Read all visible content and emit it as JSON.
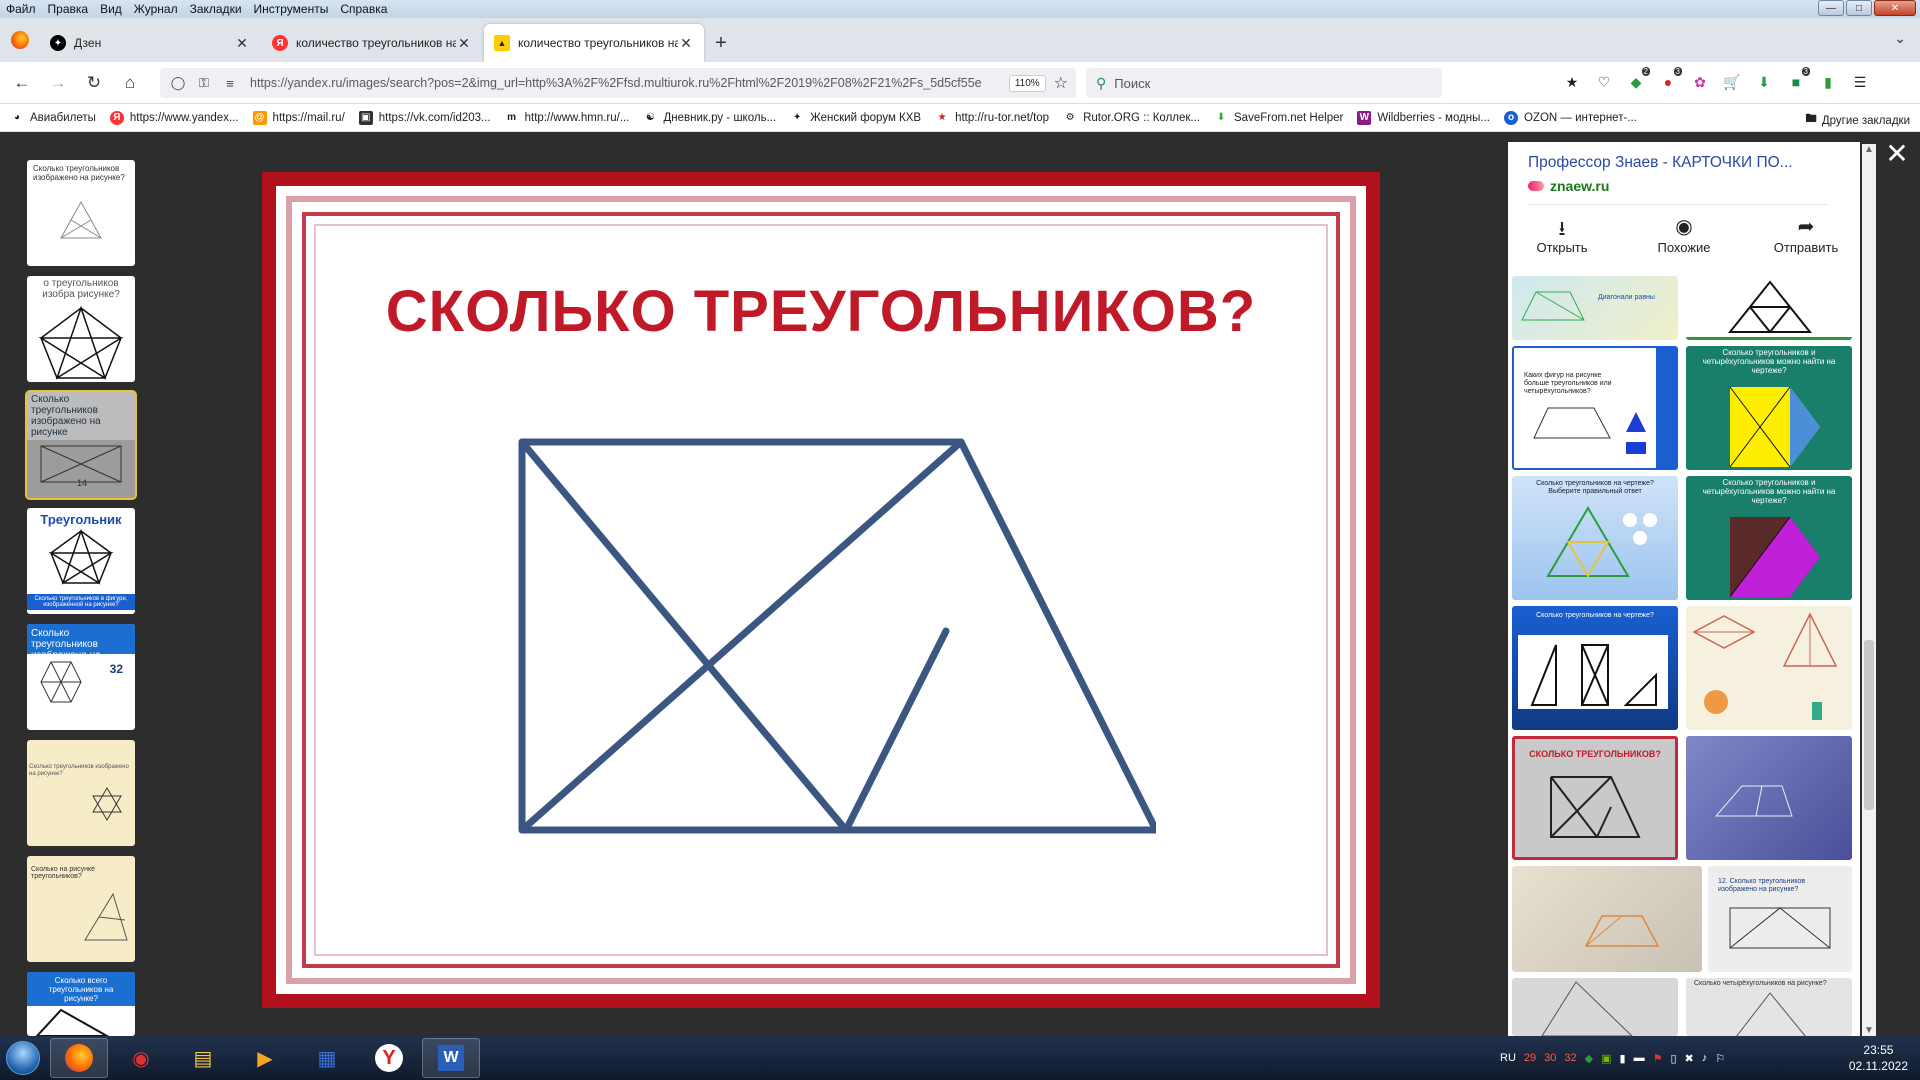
{
  "menubar": {
    "items": [
      "Файл",
      "Правка",
      "Вид",
      "Журнал",
      "Закладки",
      "Инструменты",
      "Справка"
    ]
  },
  "tabs": [
    {
      "label": "Дзен",
      "icon": "dzen-icon"
    },
    {
      "label": "количество треугольников на р",
      "icon": "yandex-icon"
    },
    {
      "label": "количество треугольников на р",
      "icon": "images-icon",
      "active": true
    }
  ],
  "navbar": {
    "url": "https://yandex.ru/images/search?pos=2&img_url=http%3A%2F%2Ffsd.multiurok.ru%2Fhtml%2F2019%2F08%2F21%2Fs_5d5cf55e",
    "zoom": "110%",
    "search_placeholder": "Поиск"
  },
  "bookmarks": [
    {
      "label": "Авиабилеты",
      "icon": "globe-icon"
    },
    {
      "label": "https://www.yandex...",
      "icon": "yandex-icon"
    },
    {
      "label": "https://mail.ru/",
      "icon": "mail-icon"
    },
    {
      "label": "https://vk.com/id203...",
      "icon": "vk-icon"
    },
    {
      "label": "http://www.hmn.ru/...",
      "icon": "hmn-icon"
    },
    {
      "label": "Дневник.ру - школь...",
      "icon": "dnevnik-icon"
    },
    {
      "label": "Женский форум КХВ",
      "icon": "forum-icon"
    },
    {
      "label": "http://ru-tor.net/top",
      "icon": "rutor-icon"
    },
    {
      "label": "Rutor.ORG :: Коллек...",
      "icon": "rutor-org-icon"
    },
    {
      "label": "SaveFrom.net Helper",
      "icon": "savefrom-icon"
    },
    {
      "label": "Wildberries - модны...",
      "icon": "wildberries-icon"
    },
    {
      "label": "OZON — интернет-...",
      "icon": "ozon-icon"
    }
  ],
  "bookmarks_other": "Другие закладки",
  "thumbnails": [
    {
      "caption": "Сколько треугольников изображено на рисунке?"
    },
    {
      "caption": "о треугольников изобра рисунке?"
    },
    {
      "caption": "Сколько треугольников изображено на рисунке",
      "number": "14"
    },
    {
      "caption": "Треугольник",
      "sub": "Сколько треугольников в фигуре, изображенной на рисунке?"
    },
    {
      "caption": "Сколько треугольников изображено на рисунке",
      "number": "32"
    },
    {
      "caption": "Сколько треугольников изображено на рисунке?"
    },
    {
      "caption": "Сколько на рисунке треугольников?"
    },
    {
      "caption": "Сколько всего треугольников на рисунке?"
    }
  ],
  "main_image": {
    "title": "СКОЛЬКО ТРЕУГОЛЬНИКОВ?"
  },
  "sidepanel": {
    "title": "Профессор Знаев - КАРТОЧКИ ПО...",
    "domain": "znaew.ru",
    "actions": [
      {
        "label": "Открыть",
        "icon": "download-icon"
      },
      {
        "label": "Похожие",
        "icon": "similar-icon"
      },
      {
        "label": "Отправить",
        "icon": "share-icon"
      }
    ],
    "tiles": [
      {
        "text": "Диагонали равны"
      },
      {
        "text": ""
      },
      {
        "text": "Каких фигур на рисунке больше треугольников или четырёхугольников?"
      },
      {
        "text": "Сколько треугольников и четырёхугольников можно найти на чертеже?"
      },
      {
        "text": "Сколько треугольников на чертеже? Выберите правильный ответ"
      },
      {
        "text": "Сколько треугольников и четырёхугольников можно найти на чертеже?"
      },
      {
        "text": "Сколько треугольников на чертеже?"
      },
      {
        "text": ""
      },
      {
        "text": "СКОЛЬКО ТРЕУГОЛЬНИКОВ?"
      },
      {
        "text": ""
      },
      {
        "text": ""
      },
      {
        "text": "12. Сколько треугольников изображено на рисунке?"
      },
      {
        "text": ""
      },
      {
        "text": "Сколько четырёхугольников на рисунке?"
      }
    ]
  },
  "taskbar": {
    "lang": "RU",
    "tray_numbers": [
      "29",
      "30",
      "32"
    ],
    "time": "23:55",
    "date": "02.11.2022"
  },
  "colors": {
    "slide_red": "#b0111d",
    "title_red": "#c01a28",
    "figure_blue": "#3b5680",
    "link_blue": "#2a49a3",
    "domain_green": "#1a7a1a"
  }
}
